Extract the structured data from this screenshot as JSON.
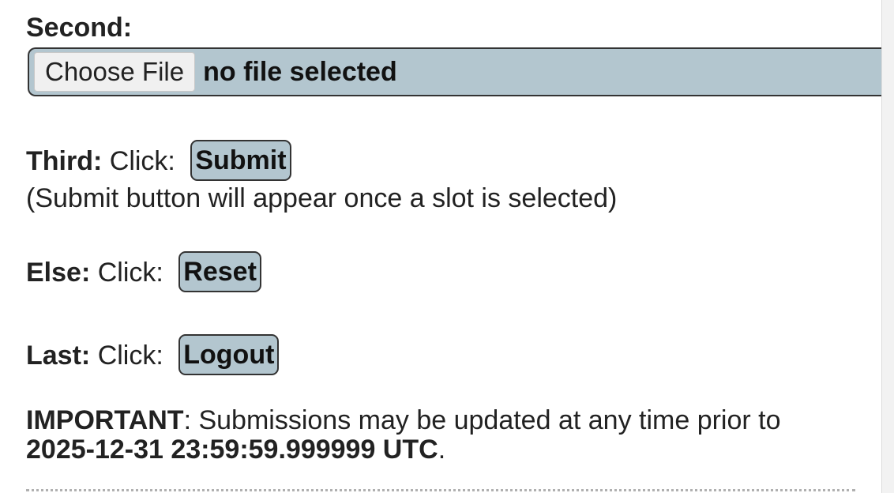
{
  "form": {
    "second": {
      "label": "Second:",
      "choose_file_label": "Choose File",
      "file_status": "no file selected"
    },
    "third": {
      "label": "Third:",
      "prefix": "Click:",
      "button_label": "Submit",
      "hint": "(Submit button will appear once a slot is selected)"
    },
    "else": {
      "label": "Else:",
      "prefix": "Click:",
      "button_label": "Reset"
    },
    "last": {
      "label": "Last:",
      "prefix": "Click:",
      "button_label": "Logout"
    },
    "important": {
      "label": "IMPORTANT",
      "text": ": Submissions may be updated at any time prior to",
      "deadline": "2025-12-31 23:59:59.999999 UTC",
      "end": "."
    }
  },
  "colors": {
    "field_bg": "#b3c6cf",
    "border": "#333333",
    "text": "#222222"
  }
}
